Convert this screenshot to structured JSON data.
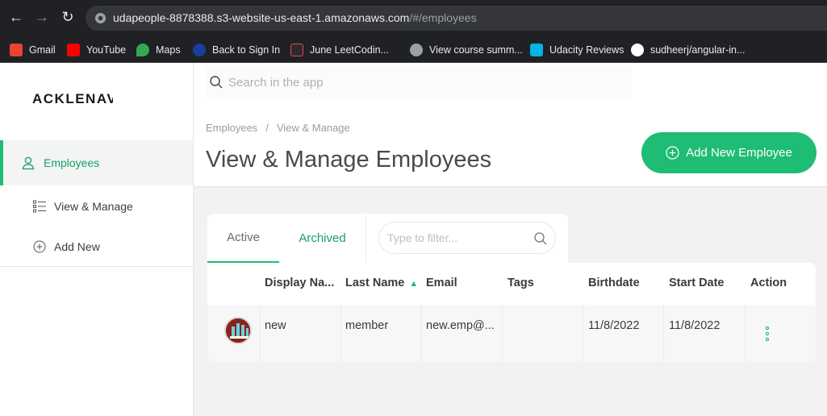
{
  "browser": {
    "url_host": "udapeople-8878388.s3-website-us-east-1.amazonaws.com",
    "url_path": "/#/employees",
    "bookmarks": [
      {
        "label": "Gmail",
        "icon": "gmail-icon",
        "color": "#ea4335"
      },
      {
        "label": "YouTube",
        "icon": "youtube-icon",
        "color": "#ff0000"
      },
      {
        "label": "Maps",
        "icon": "maps-icon",
        "color": "#34a853"
      },
      {
        "label": "Back to Sign In",
        "icon": "globe-icon",
        "color": "#1a3e9c"
      },
      {
        "label": "June LeetCodin...",
        "icon": "rocket-icon",
        "color": "#e94560"
      },
      {
        "label": "View course summ...",
        "icon": "globe-icon",
        "color": "#9aa0a6"
      },
      {
        "label": "Udacity Reviews",
        "icon": "udacity-icon",
        "color": "#02b3e4"
      },
      {
        "label": "sudheerj/angular-in...",
        "icon": "github-icon",
        "color": "#ffffff"
      }
    ]
  },
  "sidebar": {
    "logo": "ACKLENAVENUE",
    "items": [
      {
        "label": "Employees",
        "icon": "user-icon",
        "active": true
      },
      {
        "label": "View & Manage",
        "icon": "list-icon",
        "active": false
      },
      {
        "label": "Add New",
        "icon": "plus-circle-icon",
        "active": false
      }
    ]
  },
  "header": {
    "search_placeholder": "Search in the app",
    "breadcrumb": [
      "Employees",
      "View & Manage"
    ],
    "breadcrumb_sep": "/",
    "title": "View & Manage Employees",
    "add_button": "Add New Employee"
  },
  "tabs": {
    "active": "Active",
    "archived": "Archived",
    "filter_placeholder": "Type to filter..."
  },
  "table": {
    "columns": [
      "Display Na...",
      "Last Name",
      "Email",
      "Tags",
      "Birthdate",
      "Start Date",
      "Action"
    ],
    "sorted_column": "Last Name",
    "rows": [
      {
        "display_name": "new",
        "last_name": "member",
        "email": "new.emp@...",
        "tags": "",
        "birthdate": "11/8/2022",
        "start_date": "11/8/2022"
      }
    ]
  },
  "colors": {
    "accent": "#1fbc73",
    "accent_text": "#1a9d63",
    "chrome_bg": "#202124"
  }
}
